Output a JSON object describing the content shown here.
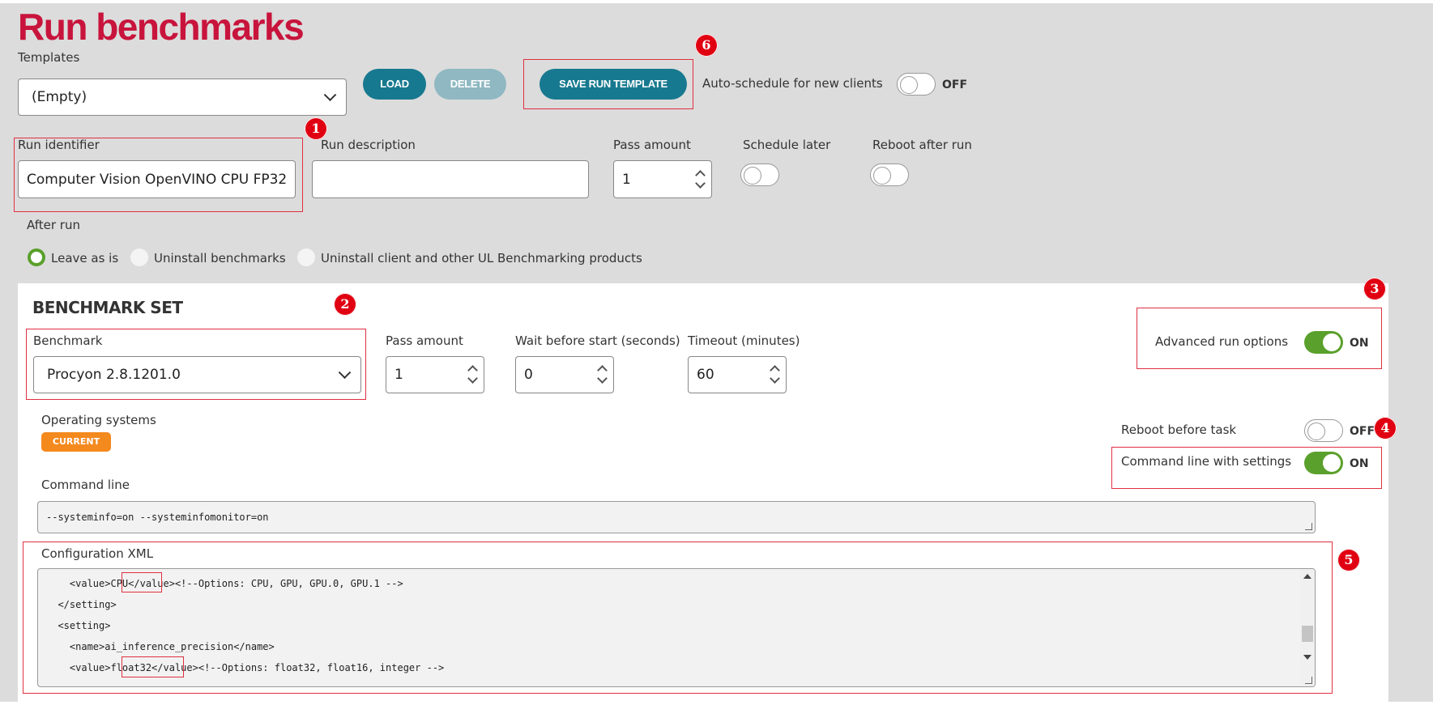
{
  "page_title": "Run benchmarks",
  "templates": {
    "label": "Templates",
    "selected": "(Empty)",
    "load_label": "LOAD",
    "delete_label": "DELETE",
    "save_label": "SAVE RUN TEMPLATE",
    "autoschedule_label": "Auto-schedule for new clients",
    "autoschedule_state": "OFF"
  },
  "run": {
    "identifier_label": "Run identifier",
    "identifier_value": "Computer Vision OpenVINO CPU FP32",
    "description_label": "Run description",
    "description_value": "",
    "pass_amount_label": "Pass amount",
    "pass_amount_value": "1",
    "schedule_later_label": "Schedule later",
    "reboot_after_label": "Reboot after run"
  },
  "after_run": {
    "label": "After run",
    "options": [
      "Leave as is",
      "Uninstall benchmarks",
      "Uninstall client and other UL Benchmarking products"
    ],
    "selected_index": 0
  },
  "benchmark_set": {
    "heading": "BENCHMARK SET",
    "benchmark_label": "Benchmark",
    "benchmark_value": "Procyon 2.8.1201.0",
    "pass_amount_label": "Pass amount",
    "pass_amount_value": "1",
    "wait_label": "Wait before start (seconds)",
    "wait_value": "0",
    "timeout_label": "Timeout (minutes)",
    "timeout_value": "60",
    "advanced_label": "Advanced run options",
    "advanced_state": "ON",
    "os_label": "Operating systems",
    "os_pill": "CURRENT",
    "reboot_before_label": "Reboot before task",
    "reboot_before_state": "OFF",
    "cmd_settings_label": "Command line with settings",
    "cmd_settings_state": "ON",
    "cmd_label": "Command line",
    "cmd_value": "--systeminfo=on --systeminfomonitor=on",
    "config_label": "Configuration XML",
    "xml_lines": [
      "    <value>CPU</value><!--Options: CPU, GPU, GPU.0, GPU.1 -->",
      "  </setting>",
      "  <setting>",
      "    <name>ai_inference_precision</name>",
      "    <value>float32</value><!--Options: float32, float16, integer -->"
    ]
  },
  "annotations": [
    "1",
    "2",
    "3",
    "4",
    "5",
    "6"
  ],
  "colors": {
    "title": "#c8143c",
    "teal": "#17798f",
    "toggle_on": "#5aa02c",
    "pill": "#f4891e",
    "annotation": "#e00012"
  }
}
